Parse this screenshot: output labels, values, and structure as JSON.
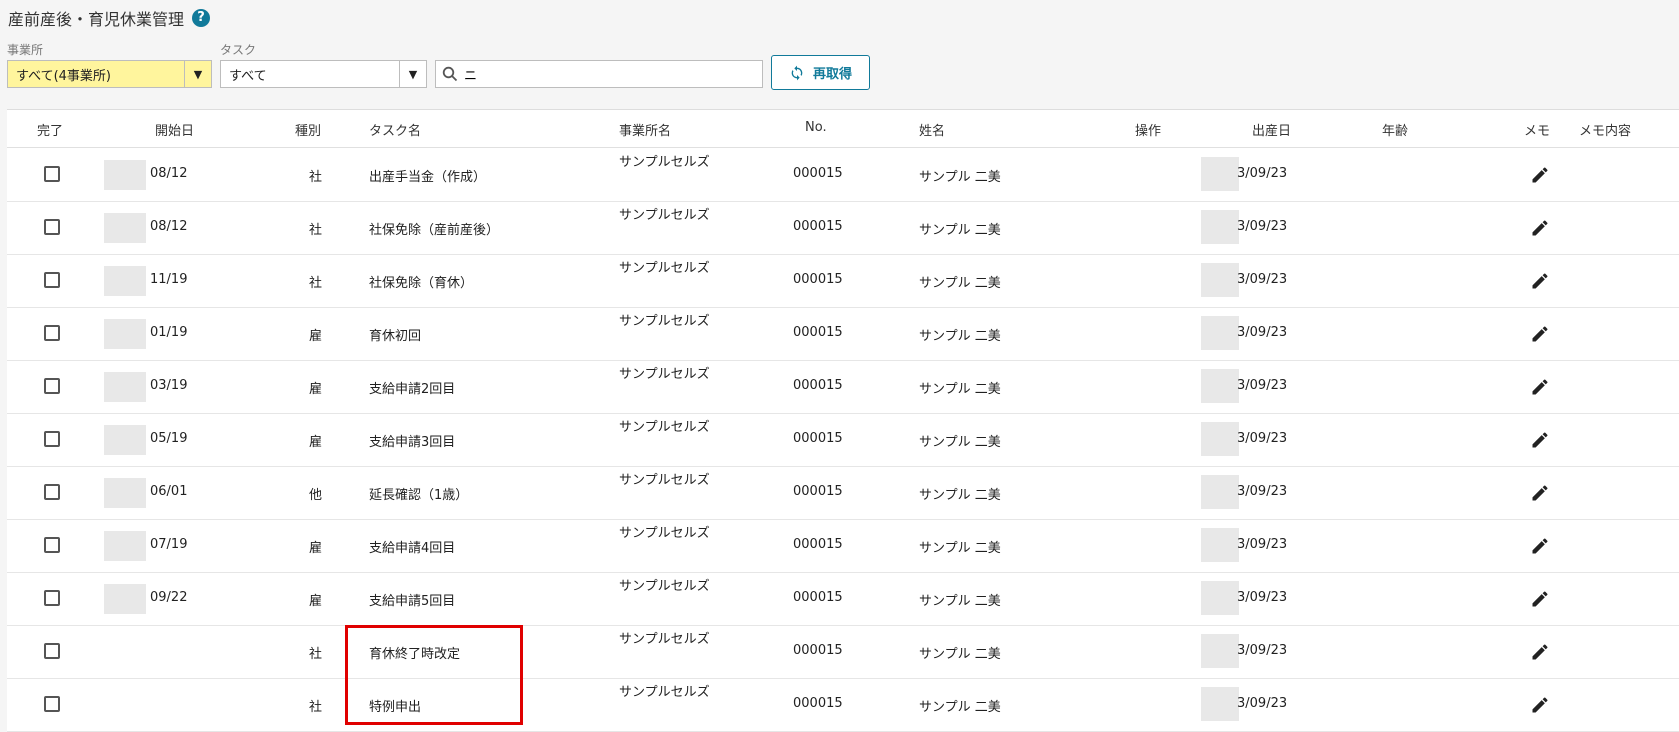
{
  "header": {
    "title": "産前産後・育児休業管理",
    "help_icon": "?"
  },
  "filters": {
    "office_label": "事業所",
    "office_value": "すべて(4事業所)",
    "task_label": "タスク",
    "task_value": "すべて",
    "search_value": "ニ",
    "dropdown_arrow": "▼",
    "refresh_label": "再取得"
  },
  "table": {
    "columns": [
      "完了",
      "開始日",
      "種別",
      "タスク名",
      "事業所名",
      "No.",
      "姓名",
      "操作",
      "出産日",
      "年齢",
      "メモ",
      "メモ内容"
    ],
    "rows": [
      {
        "start": "08/12",
        "type": "社",
        "task": "出産手当金（作成）",
        "office": "サンプルセルズ",
        "no": "000015",
        "name": "サンプル 二美",
        "birth": "3/09/23"
      },
      {
        "start": "08/12",
        "type": "社",
        "task": "社保免除（産前産後）",
        "office": "サンプルセルズ",
        "no": "000015",
        "name": "サンプル 二美",
        "birth": "3/09/23"
      },
      {
        "start": "11/19",
        "type": "社",
        "task": "社保免除（育休）",
        "office": "サンプルセルズ",
        "no": "000015",
        "name": "サンプル 二美",
        "birth": "3/09/23"
      },
      {
        "start": "01/19",
        "type": "雇",
        "task": "育休初回",
        "office": "サンプルセルズ",
        "no": "000015",
        "name": "サンプル 二美",
        "birth": "3/09/23"
      },
      {
        "start": "03/19",
        "type": "雇",
        "task": "支給申請2回目",
        "office": "サンプルセルズ",
        "no": "000015",
        "name": "サンプル 二美",
        "birth": "3/09/23"
      },
      {
        "start": "05/19",
        "type": "雇",
        "task": "支給申請3回目",
        "office": "サンプルセルズ",
        "no": "000015",
        "name": "サンプル 二美",
        "birth": "3/09/23"
      },
      {
        "start": "06/01",
        "type": "他",
        "task": "延長確認（1歳）",
        "office": "サンプルセルズ",
        "no": "000015",
        "name": "サンプル 二美",
        "birth": "3/09/23"
      },
      {
        "start": "07/19",
        "type": "雇",
        "task": "支給申請4回目",
        "office": "サンプルセルズ",
        "no": "000015",
        "name": "サンプル 二美",
        "birth": "3/09/23"
      },
      {
        "start": "09/22",
        "type": "雇",
        "task": "支給申請5回目",
        "office": "サンプルセルズ",
        "no": "000015",
        "name": "サンプル 二美",
        "birth": "3/09/23"
      },
      {
        "start": "",
        "type": "社",
        "task": "育休終了時改定",
        "office": "サンプルセルズ",
        "no": "000015",
        "name": "サンプル 二美",
        "birth": "3/09/23"
      },
      {
        "start": "",
        "type": "社",
        "task": "特例申出",
        "office": "サンプルセルズ",
        "no": "000015",
        "name": "サンプル 二美",
        "birth": "3/09/23"
      }
    ]
  },
  "icons": {
    "refresh": "refresh-icon",
    "search": "search-icon",
    "memo": "pencil-icon"
  },
  "colors": {
    "accent": "#117a9a",
    "office_select_bg": "#fff59d",
    "highlight_box": "#e00000"
  }
}
